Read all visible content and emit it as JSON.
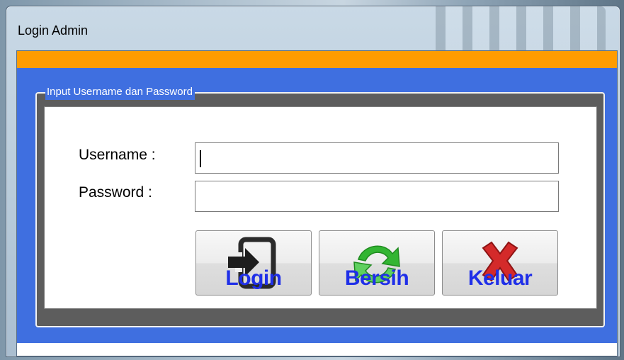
{
  "window": {
    "title": "Login Admin"
  },
  "group": {
    "legend": "Input Username dan Password"
  },
  "form": {
    "username_label": "Username :",
    "username_value": "",
    "password_label": "Password :",
    "password_value": ""
  },
  "buttons": {
    "login": "Login",
    "clear": "Bersih",
    "exit": "Keluar"
  },
  "colors": {
    "accent_orange": "#ff9c00",
    "client_blue": "#3f6fe0",
    "button_text": "#1f2fe8"
  },
  "icons": {
    "login": "login-arrow-icon",
    "clear": "refresh-arrows-icon",
    "exit": "red-x-icon"
  }
}
